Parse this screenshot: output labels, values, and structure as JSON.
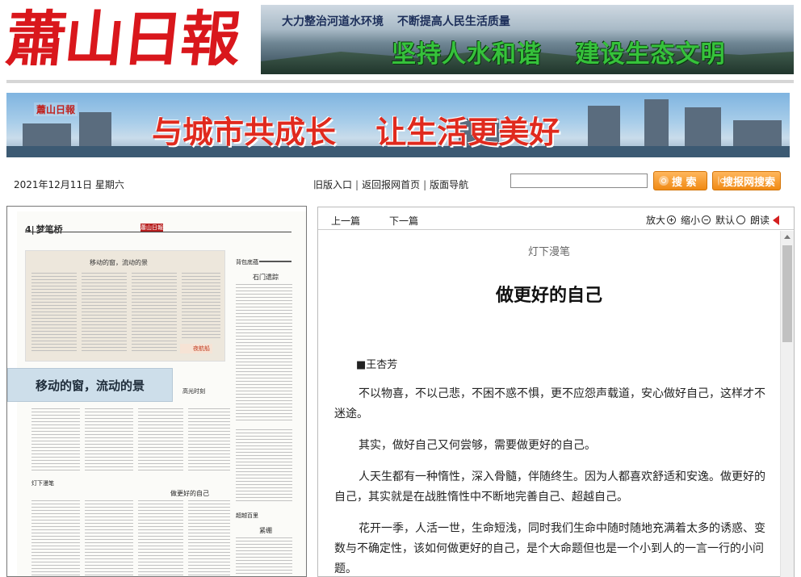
{
  "header": {
    "logo_text": "蕭山日報",
    "banner_top": {
      "line1": [
        "大力整治河道水环境",
        "不断提高人民生活质量"
      ],
      "line2": [
        "坚持人水和谐",
        "建设生态文明"
      ]
    },
    "banner_mid": {
      "logo_text": "蕭山日報",
      "slogan": [
        "与城市共成长",
        "让生活更美好"
      ]
    }
  },
  "toolbar": {
    "date": "2021年12月11日 星期六",
    "nav": [
      "旧版入口",
      "返回报网首页",
      "版面导航"
    ],
    "separator": "|",
    "search_value": "",
    "search_button": "搜 索",
    "searchweb_button": "搜报网搜索"
  },
  "paper_thumb": {
    "page_number": "4",
    "page_title": "梦笔桥",
    "logo": "蕭山日報",
    "feature_title": "移动的窗，流动的景",
    "feature_tag": "夜航船",
    "col1_heading": "背包底蕴",
    "col1_title": "石门遗踪",
    "col2_heading": "灯下漫笔",
    "col2_title": "做更好的自己",
    "col3_heading": "高光时刻",
    "col4_heading": "超越百里",
    "col4_title": "紧绷",
    "highlight": "移动的窗，流动的景"
  },
  "article": {
    "toolbar": {
      "prev": "上一篇",
      "next": "下一篇",
      "zoom_in": "放大",
      "zoom_out": "缩小",
      "default": "默认",
      "read_aloud": "朗读"
    },
    "kicker": "灯下漫笔",
    "title": "做更好的自己",
    "byline": "■王杏芳",
    "paragraphs": [
      "不以物喜，不以己悲，不困不惑不惧，更不应怨声载道，安心做好自己，这样才不迷途。",
      "其实，做好自己又何尝够，需要做更好的自己。",
      "人天生都有一种惰性，深入骨髓，伴随终生。因为人都喜欢舒适和安逸。做更好的自己，其实就是在战胜惰性中不断地完善自己、超越自己。",
      "花开一季，人活一世，生命短浅，同时我们生命中随时随地充满着太多的诱惑、变数与不确定性，该如何做更好的自己，是个大命题但也是一个小到人的一言一行的小问题。"
    ]
  },
  "colors": {
    "logo_red": "#d9171c",
    "button_orange": "#f08a14",
    "slogan_green": "#36c23b"
  }
}
